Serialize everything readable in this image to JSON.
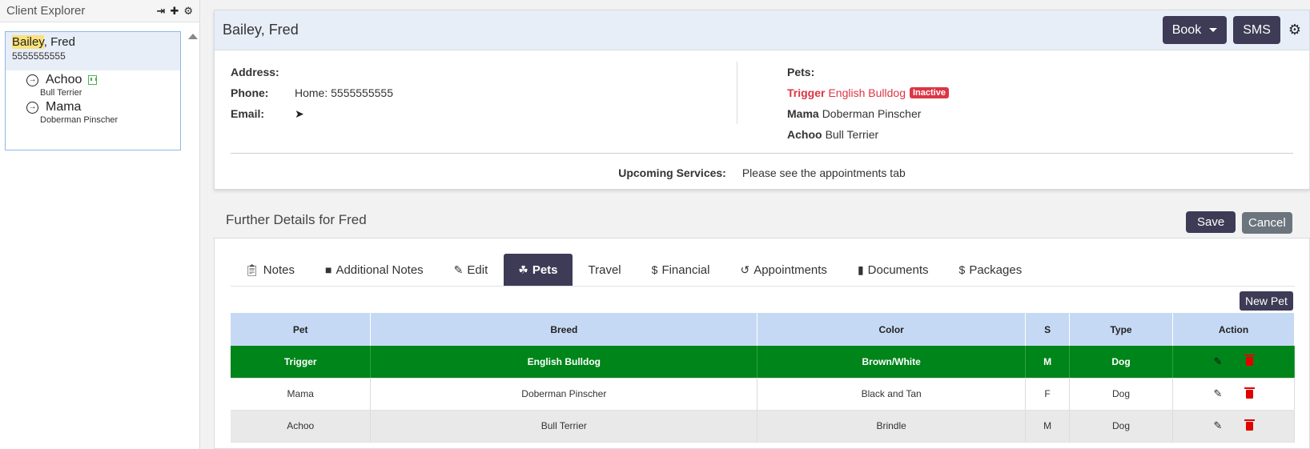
{
  "sidebar": {
    "title": "Client Explorer",
    "tools": [
      "pin-icon",
      "plus-icon",
      "gear-icon"
    ],
    "client": {
      "last_name_highlight": "Bailey",
      "name_rest": ", Fred",
      "phone": "5555555555"
    },
    "pets": [
      {
        "name": "Achoo",
        "breed": "Bull Terrier",
        "has_building_icon": true
      },
      {
        "name": "Mama",
        "breed": "Doberman Pinscher",
        "has_building_icon": false
      }
    ]
  },
  "client_card": {
    "title": "Bailey, Fred",
    "book_label": "Book",
    "sms_label": "SMS",
    "address_label": "Address:",
    "address_value": "",
    "phone_label": "Phone:",
    "phone_value": "Home: 5555555555",
    "email_label": "Email:",
    "pets_label": "Pets:",
    "pets": [
      {
        "name": "Trigger",
        "breed": "English Bulldog",
        "badge": "Inactive"
      },
      {
        "name": "Mama",
        "breed": "Doberman Pinscher"
      },
      {
        "name": "Achoo",
        "breed": "Bull Terrier"
      }
    ],
    "upcoming_label": "Upcoming Services:",
    "upcoming_value": "Please see the appointments tab"
  },
  "details": {
    "title": "Further Details for Fred",
    "save_label": "Save",
    "cancel_label": "Cancel",
    "tabs": [
      {
        "label": "Notes",
        "icon": "clipboard-icon"
      },
      {
        "label": "Additional Notes",
        "icon": "note-icon"
      },
      {
        "label": "Edit",
        "icon": "pencil-icon"
      },
      {
        "label": "Pets",
        "icon": "paw-icon",
        "active": true
      },
      {
        "label": "Travel",
        "icon": ""
      },
      {
        "label": "Financial",
        "icon": "dollar-icon"
      },
      {
        "label": "Appointments",
        "icon": "history-icon"
      },
      {
        "label": "Documents",
        "icon": "file-icon"
      },
      {
        "label": "Packages",
        "icon": "dollar-icon"
      }
    ],
    "new_pet_label": "New Pet",
    "table": {
      "headers": [
        "Pet",
        "Breed",
        "Color",
        "S",
        "Type",
        "Action"
      ],
      "rows": [
        {
          "pet": "Trigger",
          "breed": "English Bulldog",
          "color": "Brown/White",
          "sex": "M",
          "type": "Dog"
        },
        {
          "pet": "Mama",
          "breed": "Doberman Pinscher",
          "color": "Black and Tan",
          "sex": "F",
          "type": "Dog"
        },
        {
          "pet": "Achoo",
          "breed": "Bull Terrier",
          "color": "Brindle",
          "sex": "M",
          "type": "Dog"
        }
      ]
    }
  },
  "colors": {
    "accent_dark": "#3d3b55",
    "selected_row": "#00851a",
    "inactive_red": "#dc3545",
    "header_blue": "#c6d9f4"
  }
}
